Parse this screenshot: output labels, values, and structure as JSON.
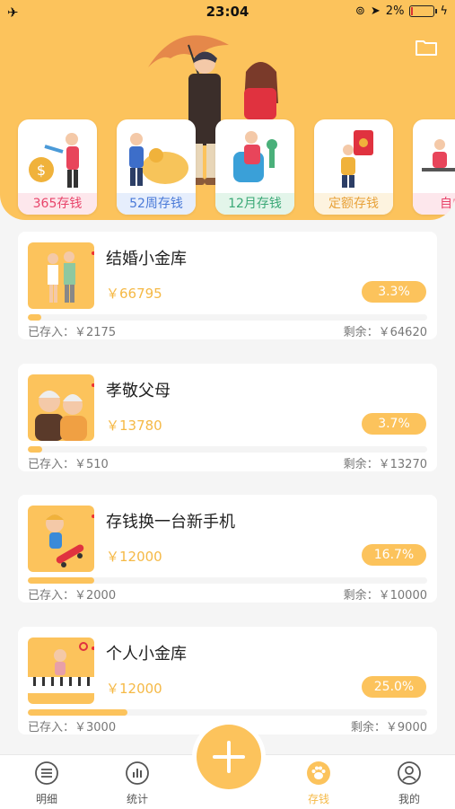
{
  "status_bar": {
    "time": "23:04",
    "battery": "2%"
  },
  "categories": [
    {
      "label": "365存钱",
      "color": "#e8456b",
      "bg": "#fde7ec"
    },
    {
      "label": "52周存钱",
      "color": "#4a7ad8",
      "bg": "#e6eefc"
    },
    {
      "label": "12月存钱",
      "color": "#3aa876",
      "bg": "#e3f5ea"
    },
    {
      "label": "定额存钱",
      "color": "#e8a23a",
      "bg": "#fdf3df"
    },
    {
      "label": "自由",
      "color": "#e8456b",
      "bg": "#fde7ec"
    }
  ],
  "goals": [
    {
      "title": "结婚小金库",
      "amount": "￥66795",
      "percent": "3.3%",
      "progress": 0.033,
      "saved": "已存入：￥2175",
      "remaining": "剩余：￥64620"
    },
    {
      "title": "孝敬父母",
      "amount": "￥13780",
      "percent": "3.7%",
      "progress": 0.037,
      "saved": "已存入：￥510",
      "remaining": "剩余：￥13270"
    },
    {
      "title": "存钱换一台新手机",
      "amount": "￥12000",
      "percent": "16.7%",
      "progress": 0.167,
      "saved": "已存入：￥2000",
      "remaining": "剩余：￥10000"
    },
    {
      "title": "个人小金库",
      "amount": "￥12000",
      "percent": "25.0%",
      "progress": 0.25,
      "saved": "已存入：￥3000",
      "remaining": "剩余：￥9000"
    }
  ],
  "tabs": [
    {
      "label": "明细",
      "icon": "list-icon"
    },
    {
      "label": "统计",
      "icon": "chart-icon"
    },
    {
      "label": "存钱",
      "icon": "paw-icon"
    },
    {
      "label": "我的",
      "icon": "user-icon"
    }
  ],
  "colors": {
    "accent": "#fcc35c",
    "accent_text": "#f5b946"
  }
}
